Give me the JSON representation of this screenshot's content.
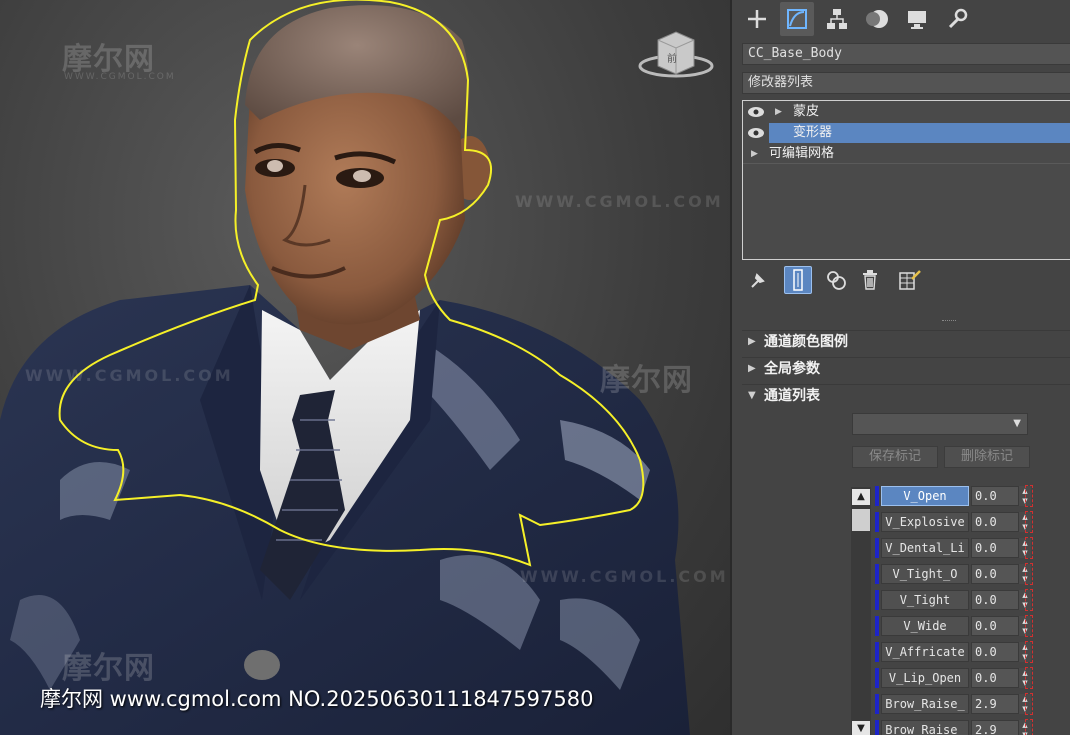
{
  "viewport": {
    "viewcube_label": "前",
    "watermark_logo": "摩尔网",
    "watermark_small": "WWW.CGMOL.COM",
    "watermark_url": "WWW.CGMOL.COM",
    "footer_watermark": "摩尔网 www.cgmol.com NO.20250630111847597580"
  },
  "panel": {
    "tabs": [
      {
        "name": "create-tab-icon",
        "active": false
      },
      {
        "name": "modify-tab-icon",
        "active": true
      },
      {
        "name": "hierarchy-tab-icon",
        "active": false
      },
      {
        "name": "motion-tab-icon",
        "active": false
      },
      {
        "name": "display-tab-icon",
        "active": false
      },
      {
        "name": "utilities-tab-icon",
        "active": false
      }
    ],
    "object_name": "CC_Base_Body",
    "modifier_list_label": "修改器列表",
    "stack": [
      {
        "label": "蒙皮",
        "expandable": true,
        "visible": true,
        "selected": false
      },
      {
        "label": "变形器",
        "expandable": false,
        "visible": true,
        "selected": true
      },
      {
        "label": "可编辑网格",
        "expandable": true,
        "visible": false,
        "selected": false
      }
    ],
    "rollouts": {
      "channel_color_legend": "通道颜色图例",
      "global_params": "全局参数",
      "channel_list": "通道列表"
    },
    "buttons": {
      "save_marker": "保存标记",
      "delete_marker": "删除标记"
    },
    "channels": [
      {
        "name": "V_Open",
        "value": "0.0",
        "active": true
      },
      {
        "name": "V_Explosive",
        "value": "0.0",
        "active": false
      },
      {
        "name": "V_Dental_Li",
        "value": "0.0",
        "active": false
      },
      {
        "name": "V_Tight_O",
        "value": "0.0",
        "active": false
      },
      {
        "name": "V_Tight",
        "value": "0.0",
        "active": false
      },
      {
        "name": "V_Wide",
        "value": "0.0",
        "active": false
      },
      {
        "name": "V_Affricate",
        "value": "0.0",
        "active": false
      },
      {
        "name": "V_Lip_Open",
        "value": "0.0",
        "active": false
      },
      {
        "name": "Brow_Raise_",
        "value": "2.9",
        "active": false
      },
      {
        "name": "Brow_Raise_",
        "value": "2.9",
        "active": false
      }
    ]
  }
}
